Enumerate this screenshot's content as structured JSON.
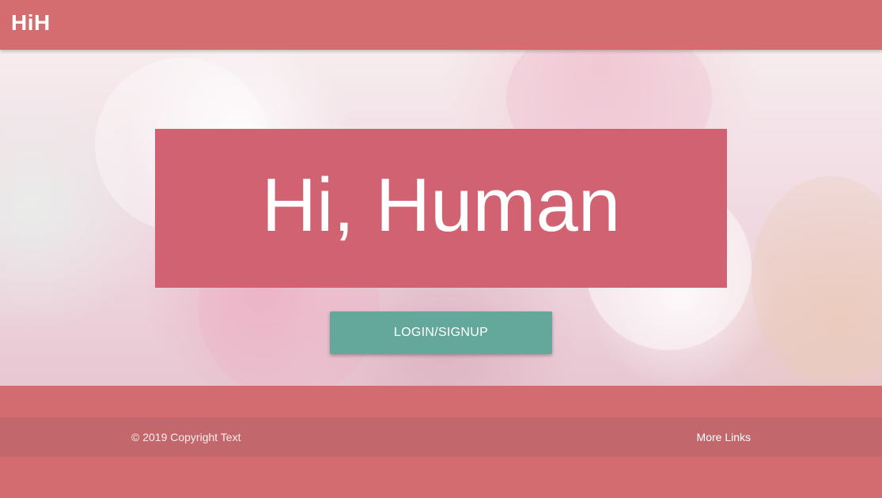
{
  "navbar": {
    "brand": "HiH"
  },
  "hero": {
    "title": "Hi, Human",
    "cta_label": "LOGIN/SIGNUP"
  },
  "footer": {
    "copyright": "© 2019 Copyright Text",
    "more_links": "More Links"
  },
  "colors": {
    "navbar_bg": "#d36d6f",
    "title_box_bg": "#d16271",
    "cta_bg": "#63a89a",
    "footer_bg": "#d36c70",
    "footer_bar_bg": "#c2686c"
  }
}
